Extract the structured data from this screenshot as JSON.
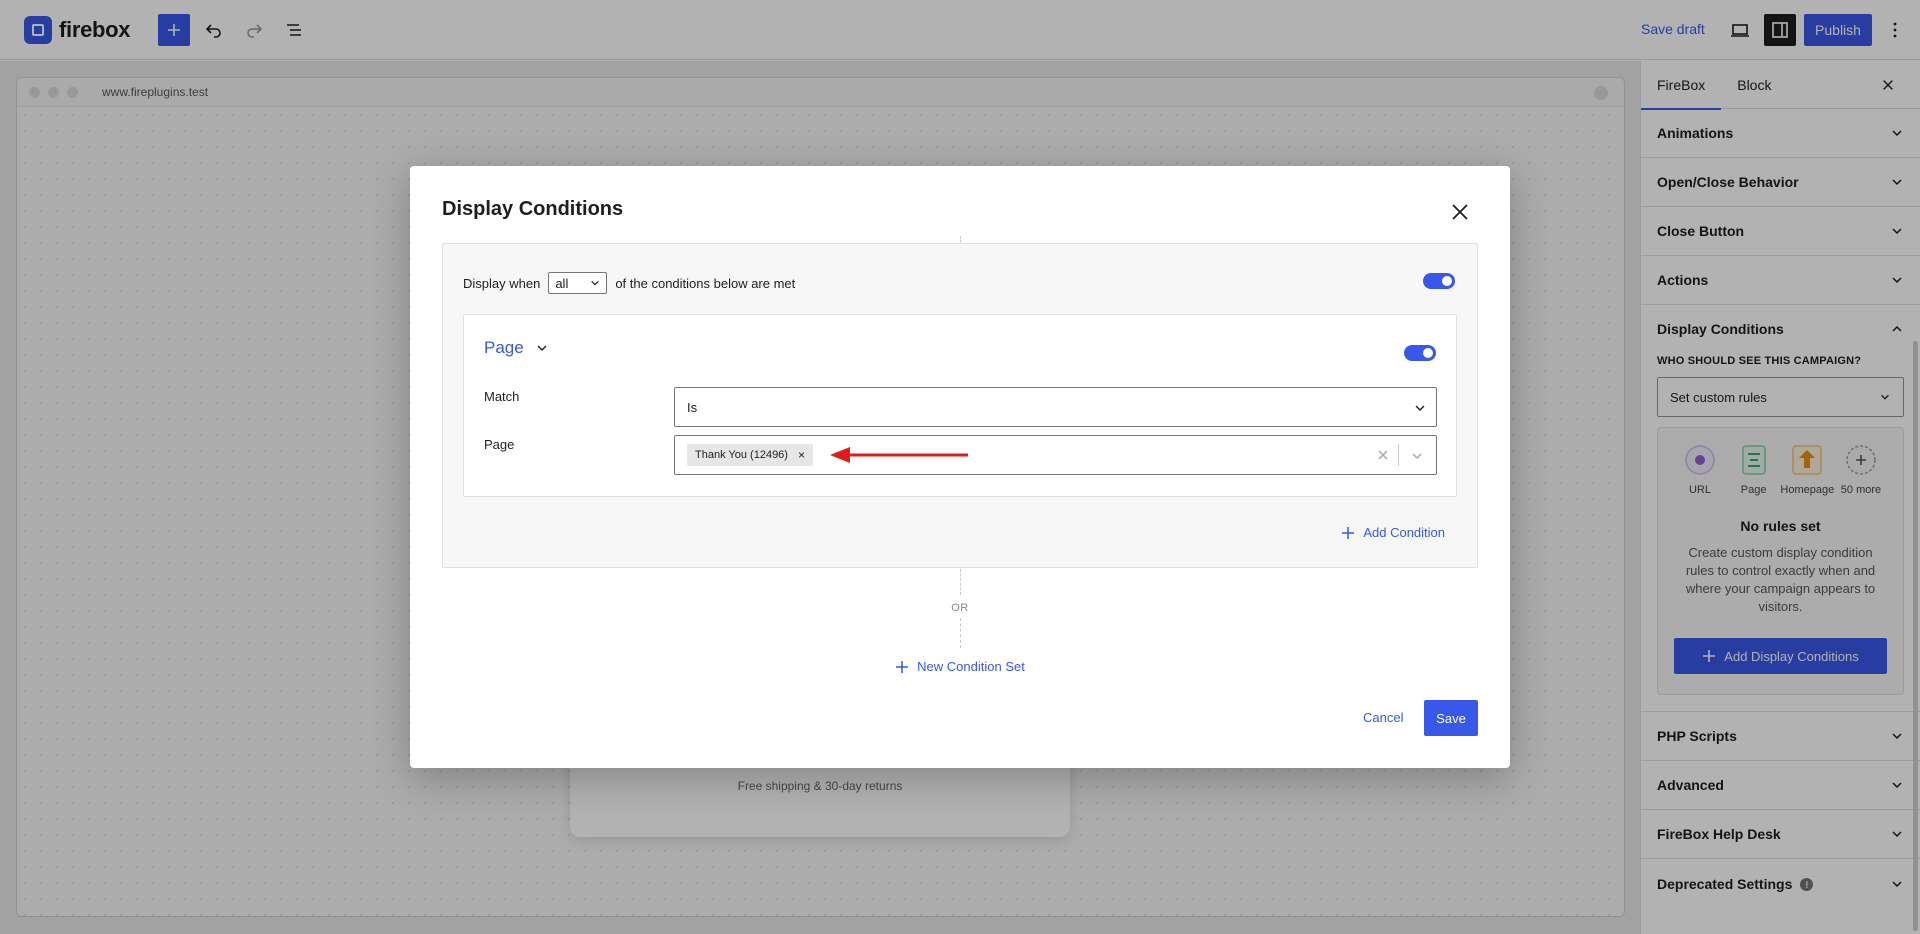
{
  "topbar": {
    "logo_text": "firebox",
    "save_draft": "Save draft",
    "publish": "Publish"
  },
  "browser": {
    "url": "www.fireplugins.test"
  },
  "canvas": {
    "popup_text": "Free shipping & 30-day returns"
  },
  "sidebar": {
    "tabs": [
      "FireBox",
      "Block"
    ],
    "panels_top": [
      "Animations",
      "Open/Close Behavior",
      "Close Button",
      "Actions"
    ],
    "display_conditions": {
      "title": "Display Conditions",
      "who_label": "WHO SHOULD SEE THIS CAMPAIGN?",
      "select_value": "Set custom rules",
      "rule_options": [
        "URL",
        "Page",
        "Homepage",
        "50 more"
      ],
      "no_rules_title": "No rules set",
      "no_rules_desc": "Create custom display condition rules to control exactly when and where your campaign appears to visitors.",
      "add_button": "Add Display Conditions"
    },
    "panels_bottom": [
      "PHP Scripts",
      "Advanced",
      "FireBox Help Desk",
      "Deprecated Settings"
    ]
  },
  "modal": {
    "title": "Display Conditions",
    "display_when_prefix": "Display when",
    "display_when_value": "all",
    "display_when_suffix": "of the conditions below are met",
    "condition": {
      "name": "Page",
      "match_label": "Match",
      "match_value": "Is",
      "page_label": "Page",
      "page_tag": "Thank You (12496)"
    },
    "add_condition": "Add Condition",
    "or_text": "OR",
    "new_condition_set": "New Condition Set",
    "cancel": "Cancel",
    "save": "Save"
  },
  "colors": {
    "accent": "#3858e9",
    "annotation_arrow": "#e01b1b"
  }
}
